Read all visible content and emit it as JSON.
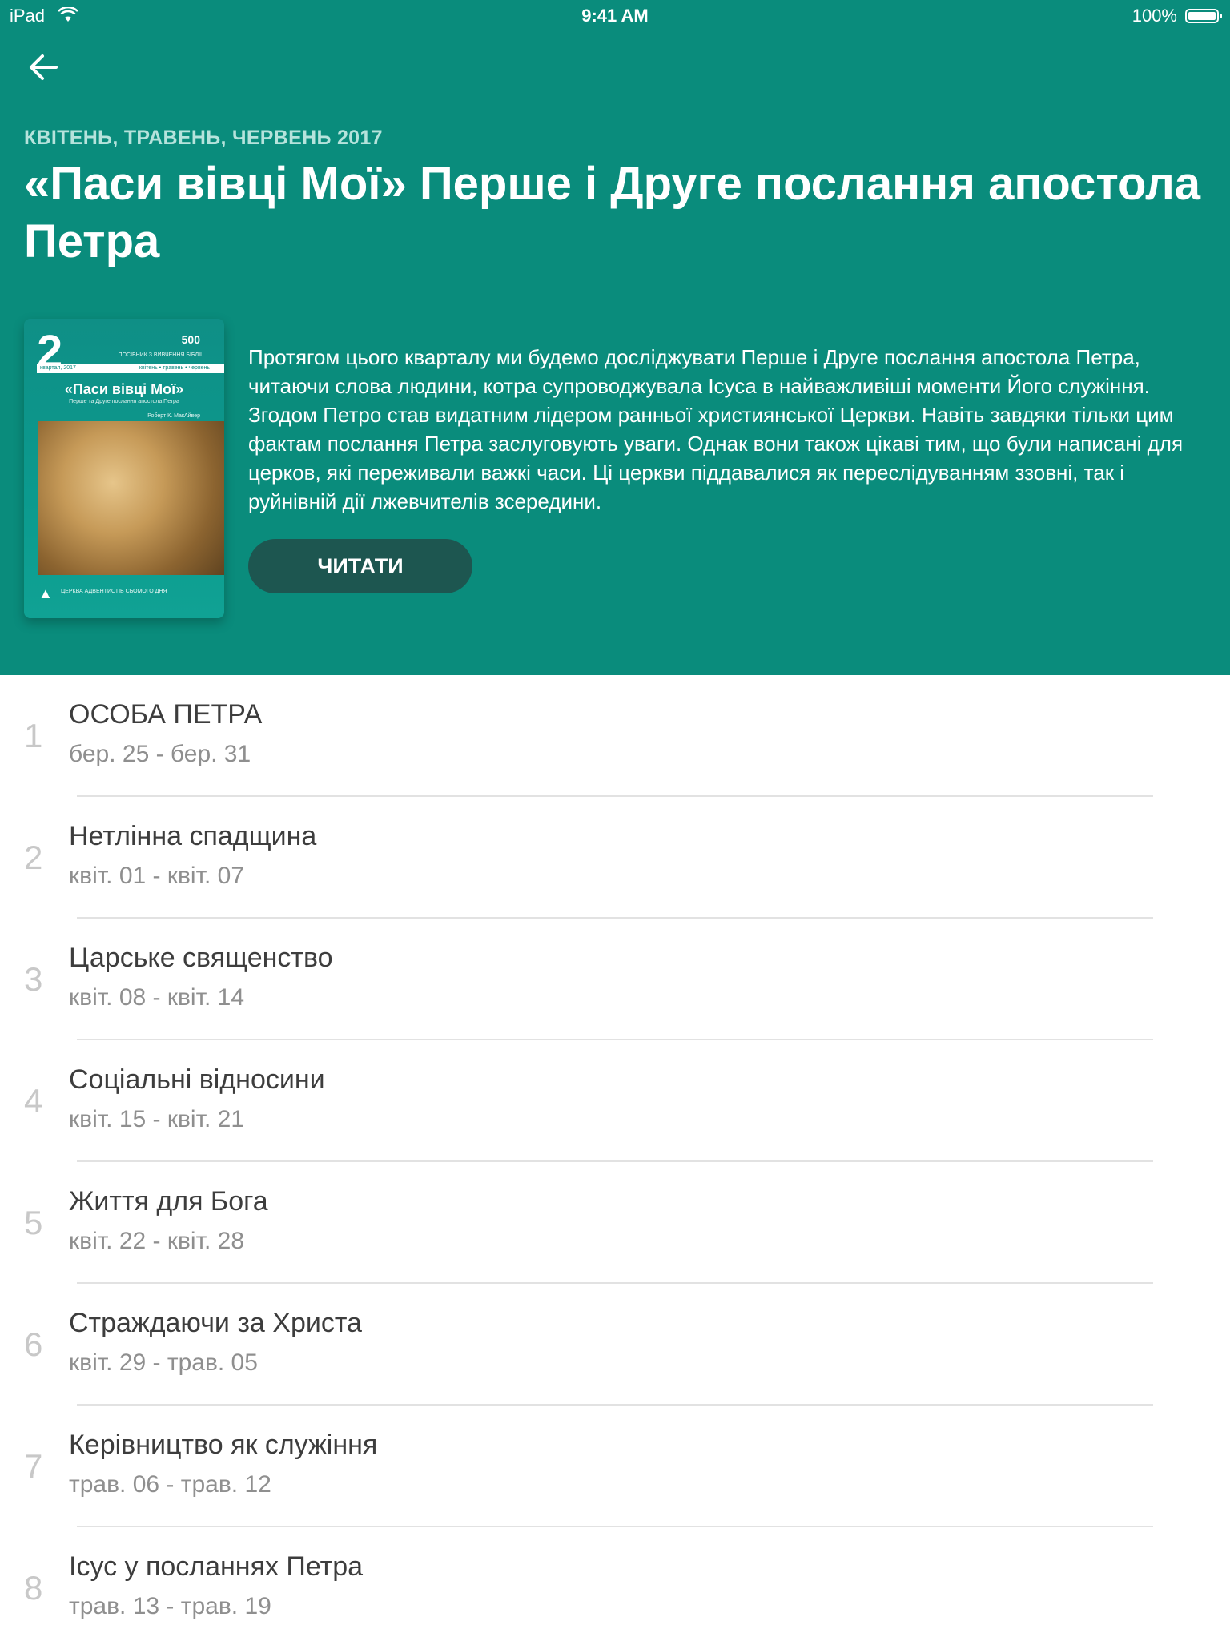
{
  "status_bar": {
    "device": "iPad",
    "time": "9:41 AM",
    "battery": "100%"
  },
  "header": {
    "quarter_label": "КВІТЕНЬ, ТРАВЕНЬ, ЧЕРВЕНЬ 2017",
    "title": "«Паси вівці Мої» Перше і Друге послання апостола Петра",
    "description": "Протягом цього кварталу ми будемо досліджувати Перше і Друге послання апостола Петра, читаючи слова людини, котра супроводжувала Ісуса в найважливіші моменти Його служіння. Згодом Петро став видатним лідером ранньої християнської Церкви. Навіть завдяки тільки цим фактам послання Петра заслуговують уваги. Однак вони також цікаві тим, що були написані для церков, які переживали важкі часи. Ці церкви піддавалися як переслідуванням ззовні, так і руйнівній дії лжевчителів зсередини.",
    "read_button": "ЧИТАТИ"
  },
  "cover": {
    "number": "2",
    "badge": "500",
    "top_line": "ПОСІБНИК З ВИВЧЕННЯ БІБЛІЇ",
    "quarter": "квартал, 2017",
    "months": "квітень • травень • червень",
    "title": "«Паси вівці Мої»",
    "subtitle": "Перше та Друге послання апостола Петра",
    "author": "Роберт К. МакАйвер",
    "church": "ЦЕРКВА АДВЕНТИСТІВ СЬОМОГО ДНЯ"
  },
  "lessons": [
    {
      "number": "1",
      "title": "ОСОБА ПЕТРА",
      "dates": "бер. 25 - бер. 31"
    },
    {
      "number": "2",
      "title": "Нетлінна спадщина",
      "dates": "квіт. 01 - квіт. 07"
    },
    {
      "number": "3",
      "title": "Царське священство",
      "dates": "квіт. 08 - квіт. 14"
    },
    {
      "number": "4",
      "title": "Соціальні відносини",
      "dates": "квіт. 15 - квіт. 21"
    },
    {
      "number": "5",
      "title": "Життя для Бога",
      "dates": "квіт. 22 - квіт. 28"
    },
    {
      "number": "6",
      "title": "Страждаючи за Христа",
      "dates": "квіт. 29 - трав. 05"
    },
    {
      "number": "7",
      "title": "Керівництво як служіння",
      "dates": "трав. 06 - трав. 12"
    },
    {
      "number": "8",
      "title": "Ісус у посланнях Петра",
      "dates": "трав. 13 - трав. 19"
    }
  ],
  "colors": {
    "hero_bg": "#0a8c7c",
    "read_button_bg": "#1d5650"
  }
}
